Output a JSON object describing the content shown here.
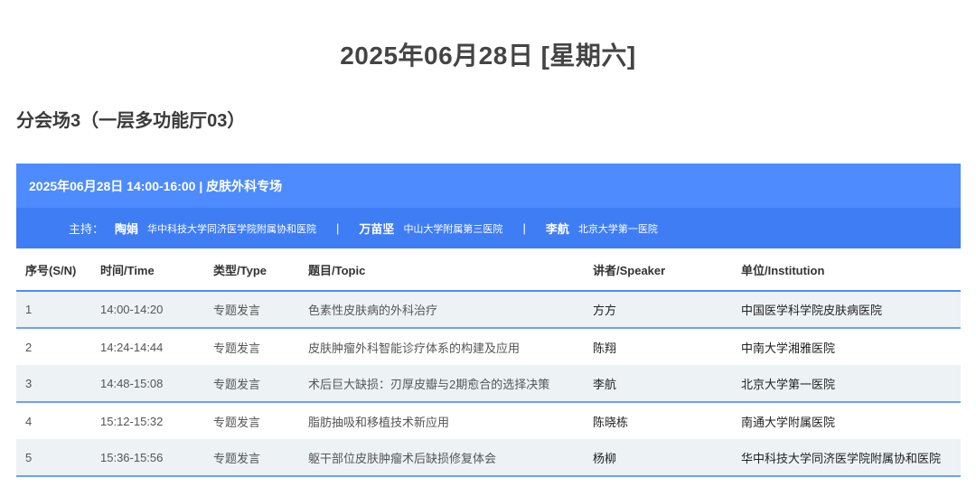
{
  "page": {
    "date_title": "2025年06月28日 [星期六]",
    "venue_title": "分会场3（一层多功能厅03）"
  },
  "session": {
    "header": "2025年06月28日 14:00-16:00 | 皮肤外科专场",
    "host_label": "主持：",
    "hosts": [
      {
        "name": "陶娟",
        "institution": "华中科技大学同济医学院附属协和医院"
      },
      {
        "name": "万苗坚",
        "institution": "中山大学附属第三医院"
      },
      {
        "name": "李航",
        "institution": "北京大学第一医院"
      }
    ],
    "separator": "|"
  },
  "table": {
    "columns": [
      "序号(S/N)",
      "时间/Time",
      "类型/Type",
      "题目/Topic",
      "讲者/Speaker",
      "单位/Institution"
    ],
    "rows": [
      {
        "sn": "1",
        "time": "14:00-14:20",
        "type": "专题发言",
        "topic": "色素性皮肤病的外科治疗",
        "speaker": "方方",
        "institution": "中国医学科学院皮肤病医院"
      },
      {
        "sn": "2",
        "time": "14:24-14:44",
        "type": "专题发言",
        "topic": "皮肤肿瘤外科智能诊疗体系的构建及应用",
        "speaker": "陈翔",
        "institution": "中南大学湘雅医院"
      },
      {
        "sn": "3",
        "time": "14:48-15:08",
        "type": "专题发言",
        "topic": "术后巨大缺损：刃厚皮瓣与2期愈合的选择决策",
        "speaker": "李航",
        "institution": "北京大学第一医院"
      },
      {
        "sn": "4",
        "time": "15:12-15:32",
        "type": "专题发言",
        "topic": "脂肪抽吸和移植技术新应用",
        "speaker": "陈晓栋",
        "institution": "南通大学附属医院"
      },
      {
        "sn": "5",
        "time": "15:36-15:56",
        "type": "专题发言",
        "topic": "躯干部位皮肤肿瘤术后缺损修复体会",
        "speaker": "杨柳",
        "institution": "华中科技大学同济医学院附属协和医院"
      }
    ]
  },
  "colors": {
    "header_blue": "#4d8bff",
    "hosts_blue": "#3f7df5",
    "row_stripe": "#edf2f5"
  }
}
